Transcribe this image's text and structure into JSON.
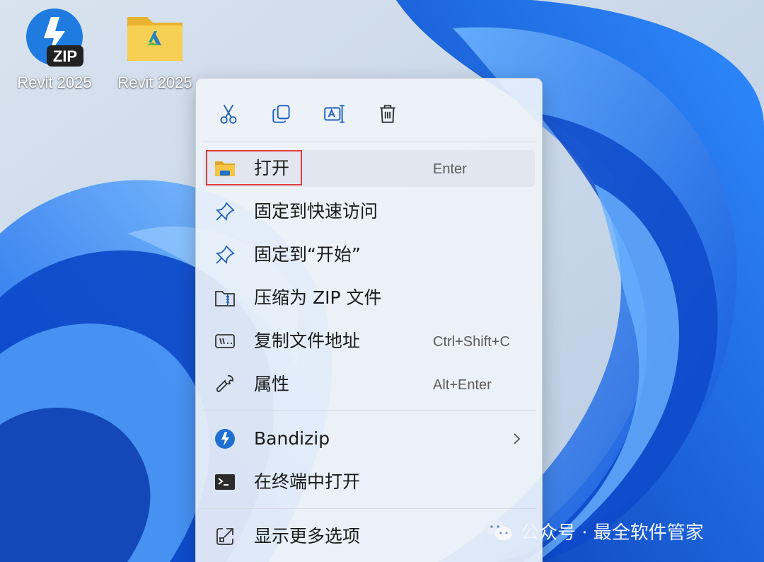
{
  "desktop": {
    "icons": [
      {
        "label": "Revit 2025",
        "badge": "ZIP",
        "icon": "bandizip-zip-icon"
      },
      {
        "label": "Revit 2025",
        "icon": "autodesk-folder-icon"
      }
    ]
  },
  "context_menu": {
    "toolbar": [
      {
        "name": "cut-icon"
      },
      {
        "name": "copy-icon"
      },
      {
        "name": "rename-icon"
      },
      {
        "name": "delete-icon"
      }
    ],
    "items": [
      {
        "label": "打开",
        "shortcut": "Enter",
        "icon": "folder-icon",
        "highlighted": true
      },
      {
        "label": "固定到快速访问",
        "icon": "pin-icon"
      },
      {
        "label": "固定到“开始”",
        "icon": "pin-icon"
      },
      {
        "label": "压缩为 ZIP 文件",
        "icon": "zip-folder-icon"
      },
      {
        "label": "复制文件地址",
        "shortcut": "Ctrl+Shift+C",
        "icon": "copy-path-icon"
      },
      {
        "label": "属性",
        "shortcut": "Alt+Enter",
        "icon": "wrench-icon"
      },
      {
        "label": "Bandizip",
        "icon": "bandizip-icon",
        "submenu": true
      },
      {
        "label": "在终端中打开",
        "icon": "terminal-icon"
      },
      {
        "label": "显示更多选项",
        "icon": "more-options-icon"
      }
    ]
  },
  "watermark": {
    "text": "公众号 · 最全软件管家",
    "icon": "wechat-icon"
  },
  "colors": {
    "highlight_box": "#e23c3c",
    "accent": "#1f6fd1",
    "menu_bg": "#f0f4fa"
  }
}
